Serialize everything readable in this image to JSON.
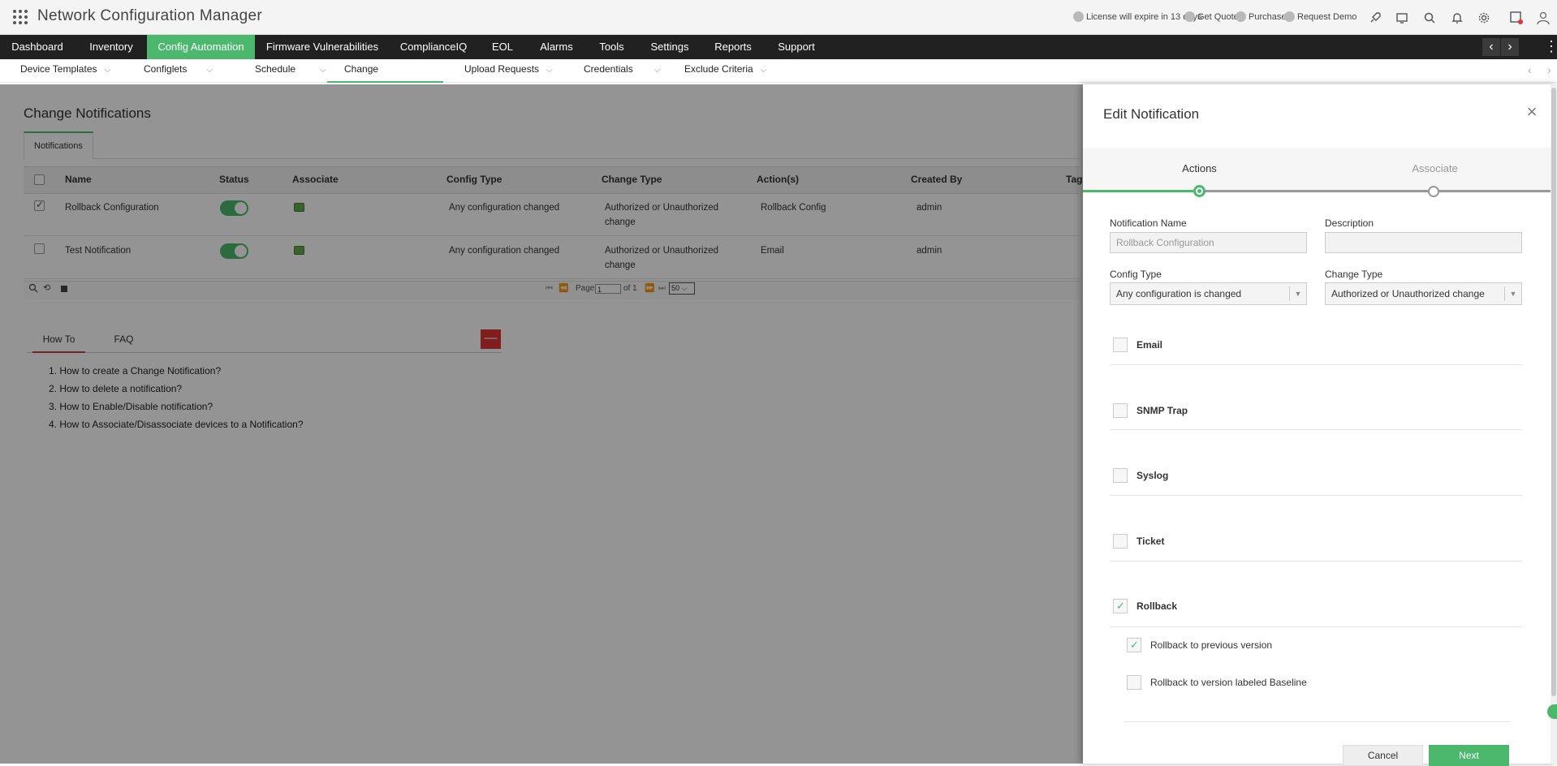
{
  "app": {
    "title": "Network Configuration Manager"
  },
  "topbar": {
    "license": "License will expire in 13 days",
    "get_quote": "Get Quote",
    "purchase": "Purchase",
    "request_demo": "Request Demo",
    "icons": [
      "rocket-icon",
      "monitor-icon",
      "search-icon",
      "bell-icon",
      "gear-icon",
      "user-alert-icon",
      "avatar-icon"
    ]
  },
  "mainnav": {
    "items": [
      "Dashboard",
      "Inventory",
      "Config Automation",
      "Firmware Vulnerabilities",
      "ComplianceIQ",
      "EOL",
      "Alarms",
      "Tools",
      "Settings",
      "Reports",
      "Support"
    ],
    "active": "Config Automation"
  },
  "subnav": {
    "items": [
      "Device Templates",
      "Configlets",
      "Schedule",
      "Change Notifications",
      "Upload Requests",
      "Credentials",
      "Exclude Criteria"
    ],
    "active": "Change Notifications"
  },
  "page": {
    "title": "Change Notifications",
    "tab": "Notifications",
    "columns": [
      "Name",
      "Status",
      "Associate",
      "Config Type",
      "Change Type",
      "Action(s)",
      "Created By",
      "Tag"
    ],
    "rows": [
      {
        "name": "Rollback Configuration",
        "config_type": "Any configuration changed",
        "change_type_1": "Authorized or Unauthorized",
        "change_type_2": "change",
        "actions": "Rollback Config",
        "created_by": "admin",
        "checked": true,
        "status_on": true
      },
      {
        "name": "Test Notification",
        "config_type": "Any configuration changed",
        "change_type_1": "Authorized or Unauthorized",
        "change_type_2": "change",
        "actions": "Email",
        "created_by": "admin",
        "checked": false,
        "status_on": true
      }
    ],
    "pager": {
      "page_label": "Page",
      "page_value": "1",
      "of_label": "of 1",
      "page_size": "50"
    }
  },
  "howto": {
    "tabs": [
      "How To",
      "FAQ"
    ],
    "collapse": "—",
    "items": [
      "1. How to create a Change Notification?",
      "2. How to delete a notification?",
      "3. How to Enable/Disable notification?",
      "4. How to Associate/Disassociate devices to a Notification?"
    ]
  },
  "panel": {
    "title": "Edit Notification",
    "steps": [
      "Actions",
      "Associate"
    ],
    "active_step": "Actions",
    "fields": {
      "notification_name_label": "Notification Name",
      "notification_name_value": "Rollback Configuration",
      "description_label": "Description",
      "description_value": "",
      "config_type_label": "Config Type",
      "config_type_value": "Any configuration is changed",
      "change_type_label": "Change Type",
      "change_type_value": "Authorized or Unauthorized change"
    },
    "actions": [
      {
        "label": "Email",
        "checked": false
      },
      {
        "label": "SNMP Trap",
        "checked": false
      },
      {
        "label": "Syslog",
        "checked": false
      },
      {
        "label": "Ticket",
        "checked": false
      },
      {
        "label": "Rollback",
        "checked": true
      }
    ],
    "rollback_options": [
      {
        "label": "Rollback to previous version",
        "checked": true
      },
      {
        "label": "Rollback to version labeled Baseline",
        "checked": false
      }
    ],
    "buttons": {
      "cancel": "Cancel",
      "next": "Next"
    }
  },
  "colors": {
    "accent": "#4cb86e",
    "nav_bg": "#212121",
    "danger": "#dd3333"
  }
}
